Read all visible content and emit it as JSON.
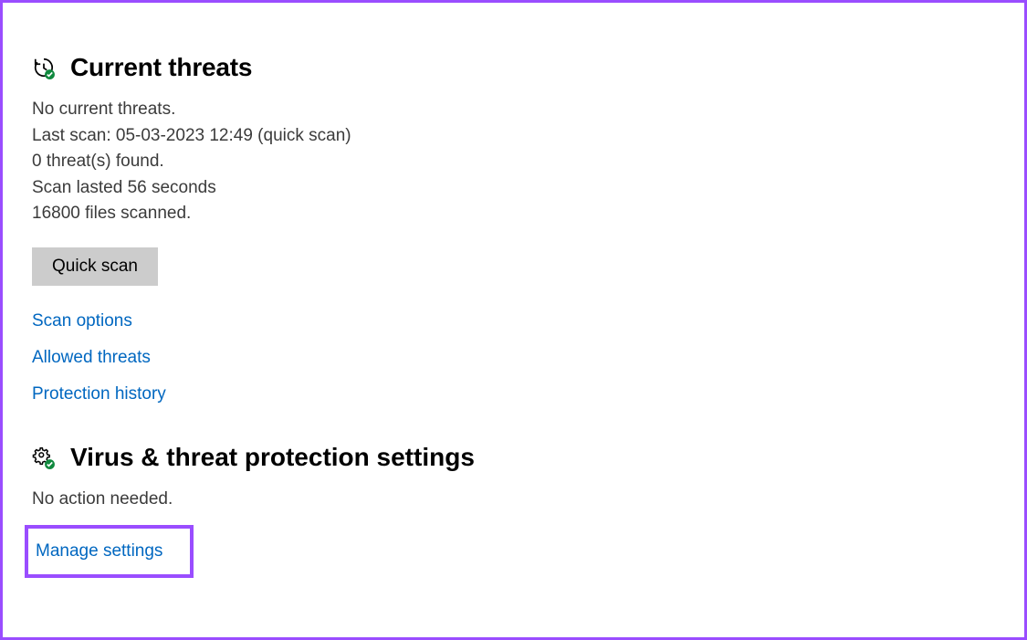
{
  "current_threats": {
    "title": "Current threats",
    "no_threats": "No current threats.",
    "last_scan": "Last scan: 05-03-2023 12:49 (quick scan)",
    "threats_found": "0 threat(s) found.",
    "scan_duration": "Scan lasted 56 seconds",
    "files_scanned": "16800 files scanned.",
    "quick_scan_button": "Quick scan",
    "links": {
      "scan_options": "Scan options",
      "allowed_threats": "Allowed threats",
      "protection_history": "Protection history"
    }
  },
  "protection_settings": {
    "title": "Virus & threat protection settings",
    "status": "No action needed.",
    "manage_link": "Manage settings"
  }
}
